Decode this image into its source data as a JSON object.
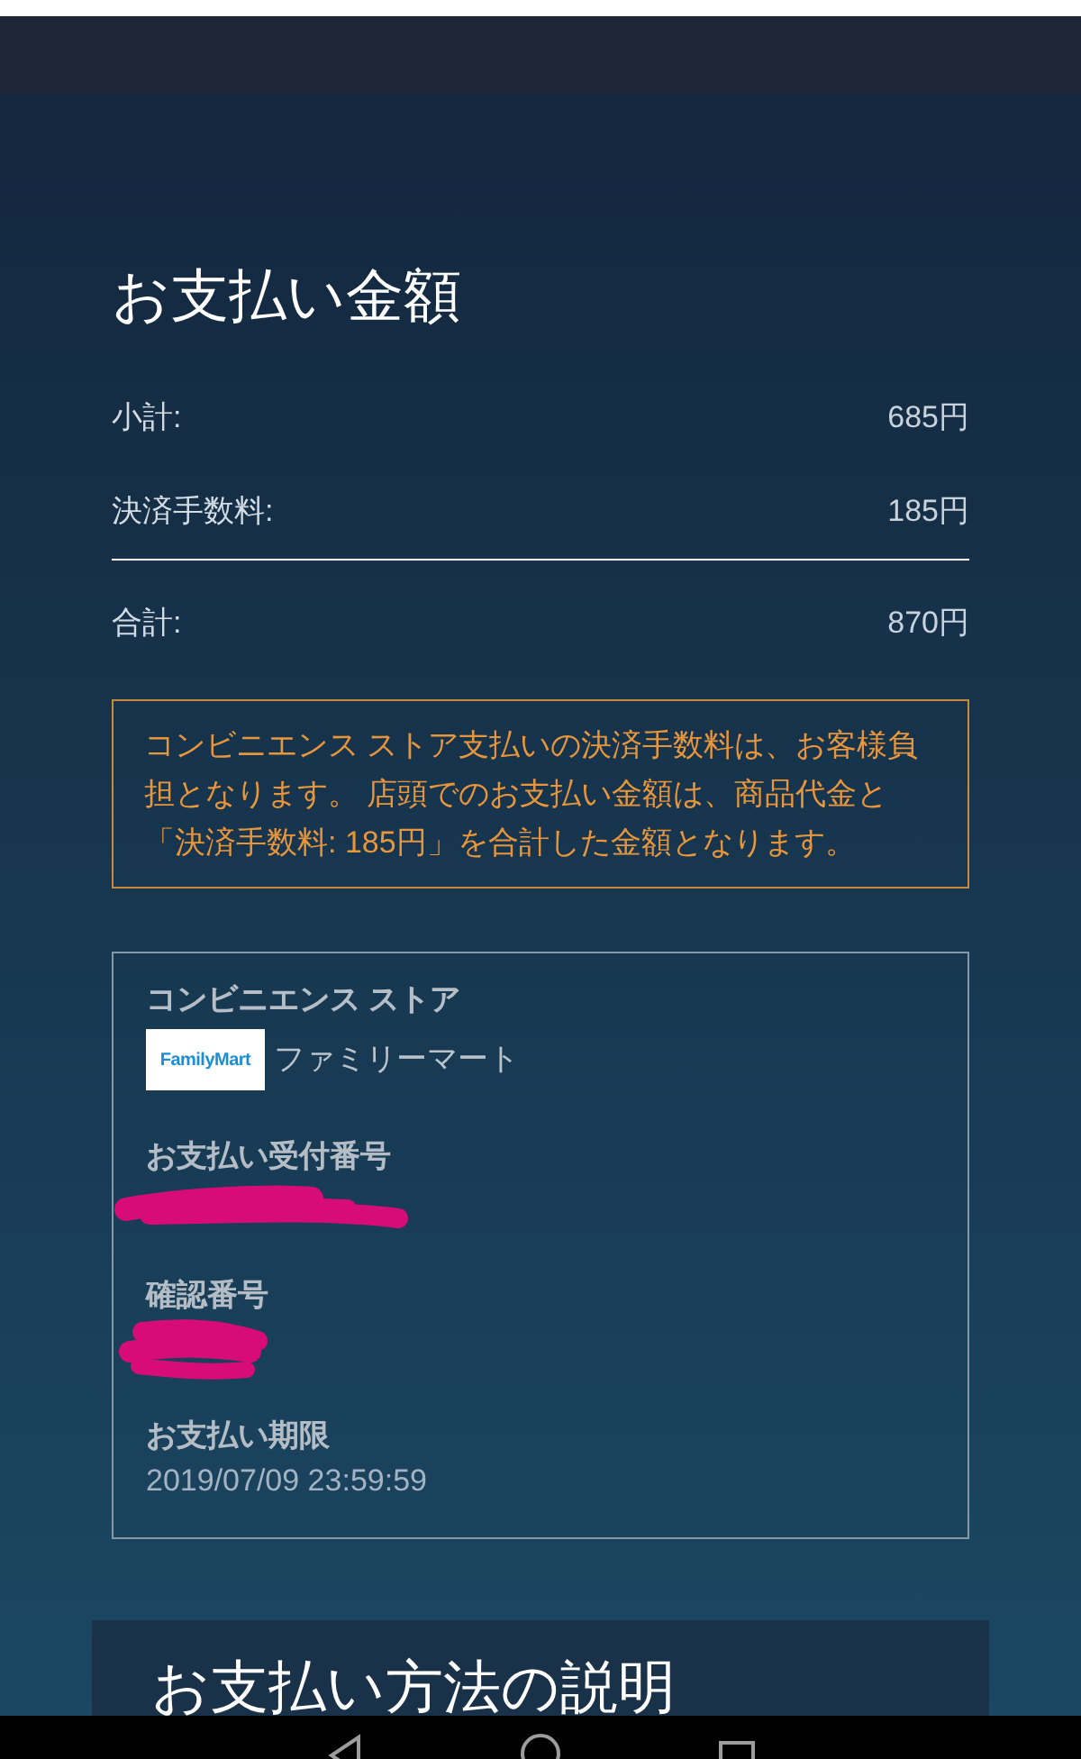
{
  "payment_summary": {
    "title": "お支払い金額",
    "rows": [
      {
        "label": "小計:",
        "value": "685円"
      },
      {
        "label": "決済手数料:",
        "value": "185円"
      }
    ],
    "total": {
      "label": "合計:",
      "value": "870円"
    }
  },
  "notice": "コンビニエンス ストア支払いの決済手数料は、お客様負担となります。 店頭でのお支払い金額は、商品代金と「決済手数料: 185円」を合計した金額となります。",
  "store_details": {
    "store_label": "コンビニエンス ストア",
    "store_logo_text": "FamilyMart",
    "store_name": "ファミリーマート",
    "fields": [
      {
        "label": "お支払い受付番号",
        "kind": "redacted"
      },
      {
        "label": "確認番号",
        "kind": "redacted"
      },
      {
        "label": "お支払い期限",
        "kind": "text",
        "value": "2019/07/09 23:59:59"
      }
    ]
  },
  "instructions": {
    "title": "お支払い方法の説明"
  }
}
